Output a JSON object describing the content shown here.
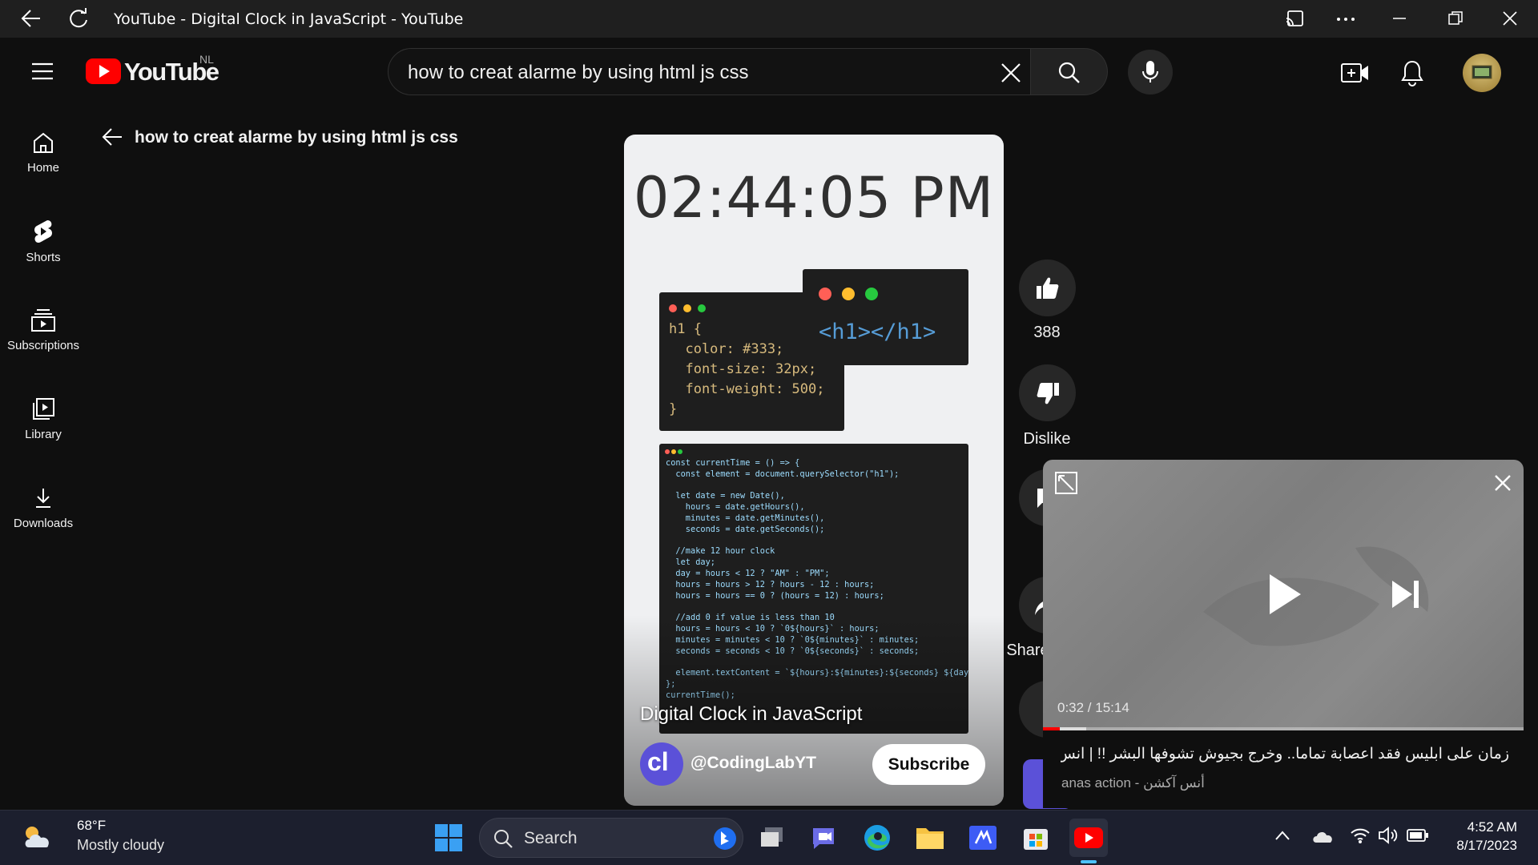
{
  "window": {
    "title": "YouTube - Digital Clock in JavaScript - YouTube"
  },
  "masthead": {
    "logo_text": "YouTube",
    "region": "NL",
    "search_value": "how to creat alarme by using html js css"
  },
  "sidebar": {
    "items": [
      {
        "label": "Home",
        "icon": "home-icon"
      },
      {
        "label": "Shorts",
        "icon": "shorts-icon"
      },
      {
        "label": "Subscriptions",
        "icon": "subscriptions-icon"
      },
      {
        "label": "Library",
        "icon": "library-icon"
      },
      {
        "label": "Downloads",
        "icon": "download-icon"
      }
    ]
  },
  "shorts_header": {
    "title": "how to creat alarme by using html js css"
  },
  "short": {
    "clock_text": "02:44:05 PM",
    "css_code": "h1 {\n  color: #333;\n  font-size: 32px;\n  font-weight: 500;\n}",
    "html_code": "<h1></h1>",
    "js_code": "const currentTime = () => {\n  const element = document.querySelector(\"h1\");\n\n  let date = new Date(),\n    hours = date.getHours(),\n    minutes = date.getMinutes(),\n    seconds = date.getSeconds();\n\n  //make 12 hour clock\n  let day;\n  day = hours < 12 ? \"AM\" : \"PM\";\n  hours = hours > 12 ? hours - 12 : hours;\n  hours = hours == 0 ? (hours = 12) : hours;\n\n  //add 0 if value is less than 10\n  hours = hours < 10 ? `0${hours}` : hours;\n  minutes = minutes < 10 ? `0${minutes}` : minutes;\n  seconds = seconds < 10 ? `0${seconds}` : seconds;\n\n  element.textContent = `${hours}:${minutes}:${seconds} ${day}`;\n};\ncurrentTime();",
    "video_title": "Digital Clock in JavaScript",
    "channel": "@CodingLabYT",
    "channel_avatar_text": "cl",
    "subscribe_label": "Subscribe"
  },
  "actions": {
    "like_count": "388",
    "dislike_label": "Dislike",
    "share_label": "Share"
  },
  "miniplayer": {
    "time": "0:32 / 15:14",
    "played_fraction": 0.035,
    "buffered_fraction": 0.09,
    "title": "زمان على ابليس فقد اعصابة تماما.. وخرج بجيوش تشوفها البشر !! | انس آكشن ...",
    "channel": "anas action - أنس آكشن"
  },
  "taskbar": {
    "weather_temp": "68°F",
    "weather_condition": "Mostly cloudy",
    "search_label": "Search",
    "time": "4:52 AM",
    "date": "8/17/2023"
  },
  "colors": {
    "youtube_red": "#ff0000",
    "background": "#0f0f0f",
    "taskbar": "#1c1f2e"
  }
}
